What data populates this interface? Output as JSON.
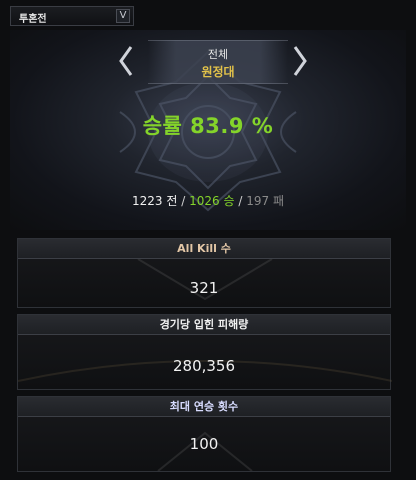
{
  "dropdown": {
    "selected": "투혼전",
    "toggle_glyph": "V"
  },
  "mode": {
    "category": "전체",
    "name": "원정대"
  },
  "winrate": "승률 83.9 %",
  "record": {
    "total": "1223 전",
    "slash1": "/",
    "wins": "1026 승",
    "slash2": "/",
    "losses": "197 패"
  },
  "stats": [
    {
      "label": "All Kill 수",
      "value": "321"
    },
    {
      "label": "경기당 입힌 피해량",
      "value": "280,356"
    },
    {
      "label": "최대 연승 횟수",
      "value": "100"
    }
  ],
  "colors": {
    "win_green": "#84d42a",
    "mode_gold": "#e3c24a",
    "loss_gray": "#8a8a8a"
  }
}
